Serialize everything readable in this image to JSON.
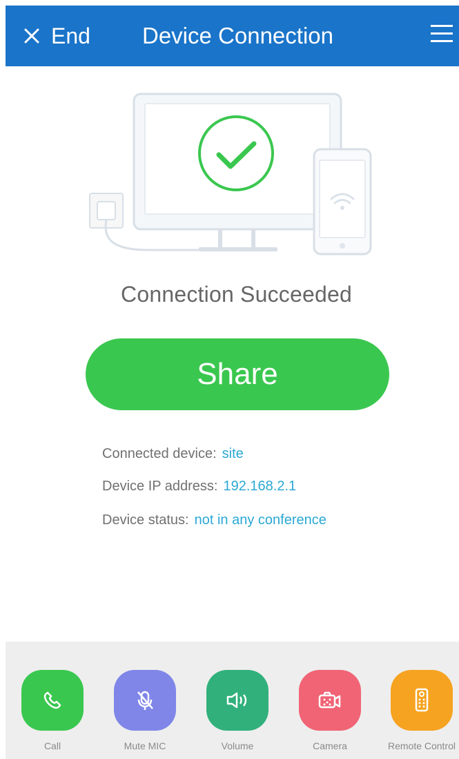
{
  "header": {
    "end_label": "End",
    "title": "Device Connection",
    "close_icon": "close-icon",
    "menu_icon": "hamburger-menu-icon"
  },
  "main": {
    "illustration_icon": "connected-devices-illustration",
    "status_text": "Connection Succeeded",
    "share_label": "Share"
  },
  "info": {
    "device_label": "Connected device:",
    "device_value": "site",
    "ip_label": "Device IP address:",
    "ip_value": "192.168.2.1",
    "status_label": "Device status:",
    "status_value": "not in any conference"
  },
  "actions": [
    {
      "label": "Call",
      "icon": "phone-icon",
      "color": "#3ac74f"
    },
    {
      "label": "Mute MIC",
      "icon": "microphone-off-icon",
      "color": "#7f86e8"
    },
    {
      "label": "Volume",
      "icon": "volume-icon",
      "color": "#31b07b"
    },
    {
      "label": "Camera",
      "icon": "camera-icon",
      "color": "#f06475"
    },
    {
      "label": "Remote Control",
      "icon": "remote-control-icon",
      "color": "#f6a321"
    }
  ],
  "colors": {
    "header_bg": "#1a74c9",
    "accent_green": "#3ac74f",
    "link_blue": "#2aa8d4",
    "bottom_bar_bg": "#eeeeee"
  }
}
